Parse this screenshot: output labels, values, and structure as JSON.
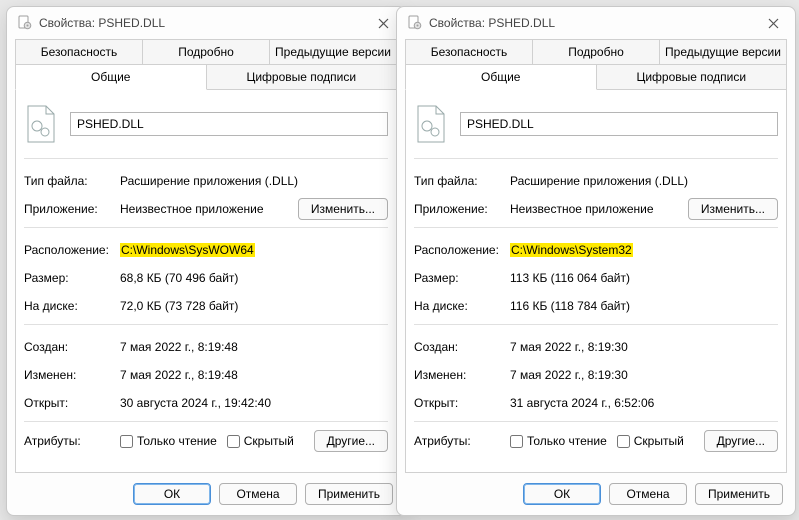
{
  "windows": [
    {
      "title": "Свойства: PSHED.DLL",
      "tabs": {
        "security": "Безопасность",
        "details": "Подробно",
        "previous": "Предыдущие версии",
        "general": "Общие",
        "signatures": "Цифровые подписи"
      },
      "filename": "PSHED.DLL",
      "labels": {
        "filetype": "Тип файла:",
        "app": "Приложение:",
        "change": "Изменить...",
        "location": "Расположение:",
        "size": "Размер:",
        "ondisk": "На диске:",
        "created": "Создан:",
        "modified": "Изменен:",
        "opened": "Открыт:",
        "attrs": "Атрибуты:",
        "readonly": "Только чтение",
        "hidden": "Скрытый",
        "other": "Другие..."
      },
      "values": {
        "filetype": "Расширение приложения (.DLL)",
        "app": "Неизвестное приложение",
        "location": "C:\\Windows\\SysWOW64",
        "size": "68,8 КБ (70 496 байт)",
        "ondisk": "72,0 КБ (73 728 байт)",
        "created": "7 мая 2022 г., 8:19:48",
        "modified": "7 мая 2022 г., 8:19:48",
        "opened": "30 августа 2024 г., 19:42:40"
      },
      "footer": {
        "ok": "ОК",
        "cancel": "Отмена",
        "apply": "Применить"
      }
    },
    {
      "title": "Свойства: PSHED.DLL",
      "tabs": {
        "security": "Безопасность",
        "details": "Подробно",
        "previous": "Предыдущие версии",
        "general": "Общие",
        "signatures": "Цифровые подписи"
      },
      "filename": "PSHED.DLL",
      "labels": {
        "filetype": "Тип файла:",
        "app": "Приложение:",
        "change": "Изменить...",
        "location": "Расположение:",
        "size": "Размер:",
        "ondisk": "На диске:",
        "created": "Создан:",
        "modified": "Изменен:",
        "opened": "Открыт:",
        "attrs": "Атрибуты:",
        "readonly": "Только чтение",
        "hidden": "Скрытый",
        "other": "Другие..."
      },
      "values": {
        "filetype": "Расширение приложения (.DLL)",
        "app": "Неизвестное приложение",
        "location": "C:\\Windows\\System32",
        "size": "113 КБ (116 064 байт)",
        "ondisk": "116 КБ (118 784 байт)",
        "created": "7 мая 2022 г., 8:19:30",
        "modified": "7 мая 2022 г., 8:19:30",
        "opened": "31 августа 2024 г., 6:52:06"
      },
      "footer": {
        "ok": "ОК",
        "cancel": "Отмена",
        "apply": "Применить"
      }
    }
  ]
}
